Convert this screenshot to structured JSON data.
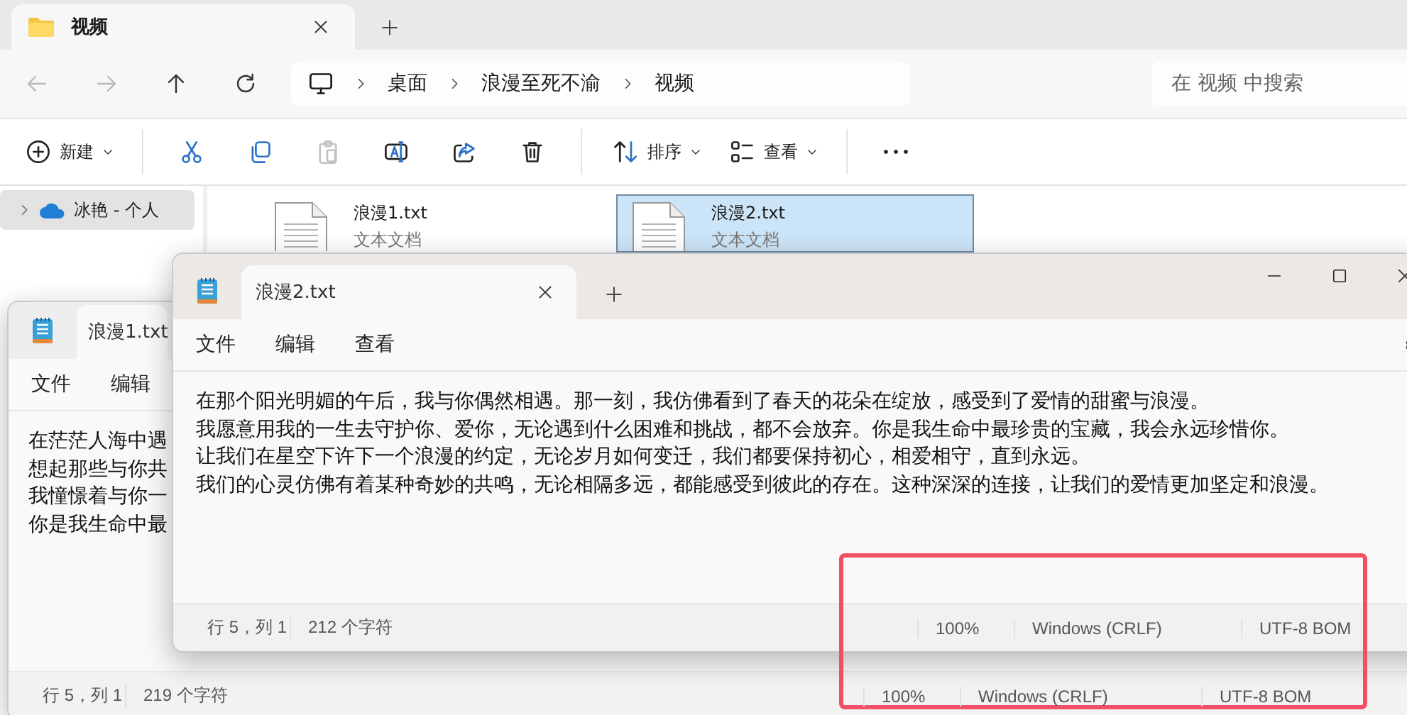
{
  "explorer": {
    "tabs": [
      {
        "label": "视频",
        "selected": true
      }
    ],
    "navigation": [
      {
        "kind": "back",
        "disabled": true
      },
      {
        "kind": "forward",
        "disabled": true
      },
      {
        "kind": "up",
        "disabled": false
      },
      {
        "kind": "refresh",
        "disabled": false
      }
    ],
    "breadcrumbs": [
      "桌面",
      "浪漫至死不渝",
      "视频"
    ],
    "search": {
      "placeholder": "在 视频 中搜索"
    },
    "toolbar": [
      {
        "kind": "new",
        "label": "新建",
        "dropdown": true,
        "disabled": false
      },
      {
        "kind": "cut",
        "dropdown": false,
        "disabled": false
      },
      {
        "kind": "copy",
        "dropdown": false,
        "disabled": false
      },
      {
        "kind": "paste",
        "dropdown": false,
        "disabled": true
      },
      {
        "kind": "rename",
        "dropdown": false,
        "disabled": false
      },
      {
        "kind": "share",
        "dropdown": false,
        "disabled": false
      },
      {
        "kind": "delete",
        "dropdown": false,
        "disabled": false
      },
      {
        "kind": "sort",
        "label": "排序",
        "dropdown": true,
        "disabled": false
      },
      {
        "kind": "view",
        "label": "查看",
        "dropdown": true,
        "disabled": false
      },
      {
        "kind": "more",
        "dropdown": false,
        "disabled": false
      }
    ],
    "sidebar": {
      "items": [
        {
          "label": "冰艳 - 个人",
          "selected": true,
          "expanded": false
        }
      ]
    },
    "files": [
      {
        "name": "浪漫1.txt",
        "type": "文本文档",
        "selected": false
      },
      {
        "name": "浪漫2.txt",
        "type": "文本文档",
        "selected": true
      }
    ]
  },
  "notepads": [
    {
      "tabs": [
        {
          "label": "浪漫1.txt",
          "selected": true
        }
      ],
      "menu": [
        "文件",
        "编辑"
      ],
      "lines": [
        "在茫茫人海中遇",
        "想起那些与你共",
        "我憧憬着与你一",
        "你是我生命中最"
      ],
      "status": {
        "position": "行 5，列 1",
        "count": "219 个字符",
        "zoom": "100%",
        "line_ending": "Windows (CRLF)",
        "encoding": "UTF-8 BOM"
      }
    },
    {
      "tabs": [
        {
          "label": "浪漫2.txt",
          "selected": true
        }
      ],
      "menu": [
        "文件",
        "编辑",
        "查看"
      ],
      "lines": [
        "在那个阳光明媚的午后，我与你偶然相遇。那一刻，我仿佛看到了春天的花朵在绽放，感受到了爱情的甜蜜与浪漫。",
        "我愿意用我的一生去守护你、爱你，无论遇到什么困难和挑战，都不会放弃。你是我生命中最珍贵的宝藏，我会永远珍惜你。",
        "让我们在星空下许下一个浪漫的约定，无论岁月如何变迁，我们都要保持初心，相爱相守，直到永远。",
        "我们的心灵仿佛有着某种奇妙的共鸣，无论相隔多远，都能感受到彼此的存在。这种深深的连接，让我们的爱情更加坚定和浪漫。"
      ],
      "status": {
        "position": "行 5，列 1",
        "count": "212 个字符",
        "zoom": "100%",
        "line_ending": "Windows (CRLF)",
        "encoding": "UTF-8 BOM"
      }
    }
  ]
}
